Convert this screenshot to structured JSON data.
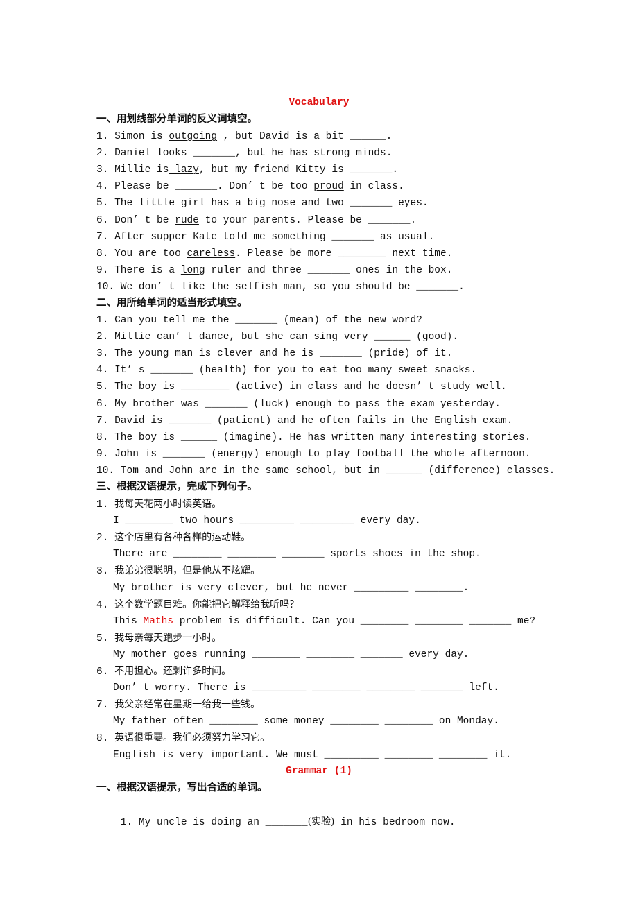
{
  "vocab_title": "Vocabulary",
  "section1": {
    "heading": "一、用划线部分单词的反义词填空。",
    "items": [
      {
        "num": "1.",
        "pre": " Simon is ",
        "u": "outgoing",
        "post": " , but David is a bit ______."
      },
      {
        "num": "2.",
        "pre": " Daniel looks _______, but he has ",
        "u": "strong",
        "post": " minds."
      },
      {
        "num": "3.",
        "pre": " Millie is",
        "u": " lazy",
        "post": ", but my friend Kitty is _______."
      },
      {
        "num": "4.",
        "pre": " Please be _______. Don’ t be too ",
        "u": "proud",
        "post": " in class."
      },
      {
        "num": "5.",
        "pre": " The little girl has a ",
        "u": "big",
        "post": " nose and two _______ eyes."
      },
      {
        "num": "6.",
        "pre": " Don’ t be ",
        "u": "rude",
        "post": " to your parents. Please be _______."
      },
      {
        "num": "7.",
        "pre": " After supper Kate told me something _______ as ",
        "u": "usual",
        "post": "."
      },
      {
        "num": "8.",
        "pre": " You are too ",
        "u": "careless",
        "post": ". Please be more ________ next time."
      },
      {
        "num": "9.",
        "pre": " There is a ",
        "u": "long",
        "post": " ruler and three _______ ones in the box."
      },
      {
        "num": "10.",
        "pre": " We don’ t like the ",
        "u": "selfish",
        "post": " man, so you should be _______."
      }
    ]
  },
  "section2": {
    "heading": "二、用所给单词的适当形式填空。",
    "items": [
      "1. Can you tell me the _______ (mean) of the new word?",
      "2. Millie can’ t dance, but she can sing very ______ (good).",
      "3. The young man is clever and he is _______ (pride) of it.",
      "4. It’ s _______ (health) for you to eat too many sweet snacks.",
      "5. The boy is ________ (active) in class and he doesn’ t study well.",
      "6. My brother was _______ (luck) enough to pass the exam yesterday.",
      "7. David is _______ (patient) and he often fails in the English exam.",
      "8. The boy is ______ (imagine). He has written many interesting stories.",
      "9. John is _______ (energy) enough to play football the whole afternoon.",
      "10. Tom and John are in the same school, but in ______ (difference) classes."
    ]
  },
  "section3": {
    "heading": "三、根据汉语提示，完成下列句子。",
    "items": [
      {
        "num": "1.",
        "cn": "我每天花两小时读英语。",
        "en": "I ________ two hours _________ _________ every day."
      },
      {
        "num": "2.",
        "cn": "这个店里有各种各样的运动鞋。",
        "en": "There are ________ ________ _______ sports shoes in the shop."
      },
      {
        "num": "3.",
        "cn": "我弟弟很聪明，但是他从不炫耀。",
        "en": "My brother is very clever, but he never _________ ________."
      },
      {
        "num": "4.",
        "cn": "这个数学题目难。你能把它解释给我听吗？",
        "en_pre": "This ",
        "en_red": "Maths",
        "en": " problem is difficult. Can you ________ ________ _______ me?"
      },
      {
        "num": "5.",
        "cn": "我母亲每天跑步一小时。",
        "en": "My mother goes running ________ ________ _______ every day."
      },
      {
        "num": "6.",
        "cn": "不用担心。还剩许多时间。",
        "en": "Don’ t worry. There is _________ ________ ________ _______ left."
      },
      {
        "num": "7.",
        "cn": "我父亲经常在星期一给我一些钱。",
        "en": "My father often ________ some money ________ ________ on Monday."
      },
      {
        "num": "8.",
        "cn": "英语很重要。我们必须努力学习它。",
        "en": "English is very important. We must _________ ________ ________ it."
      }
    ]
  },
  "grammar_title": "Grammar (1)",
  "grammar1": {
    "heading": "一、根据汉语提示，写出合适的单词。",
    "items": [
      {
        "pre": "1. My uncle is doing an _______",
        "cn": "(实验)",
        "post": " in his bedroom now."
      }
    ]
  }
}
